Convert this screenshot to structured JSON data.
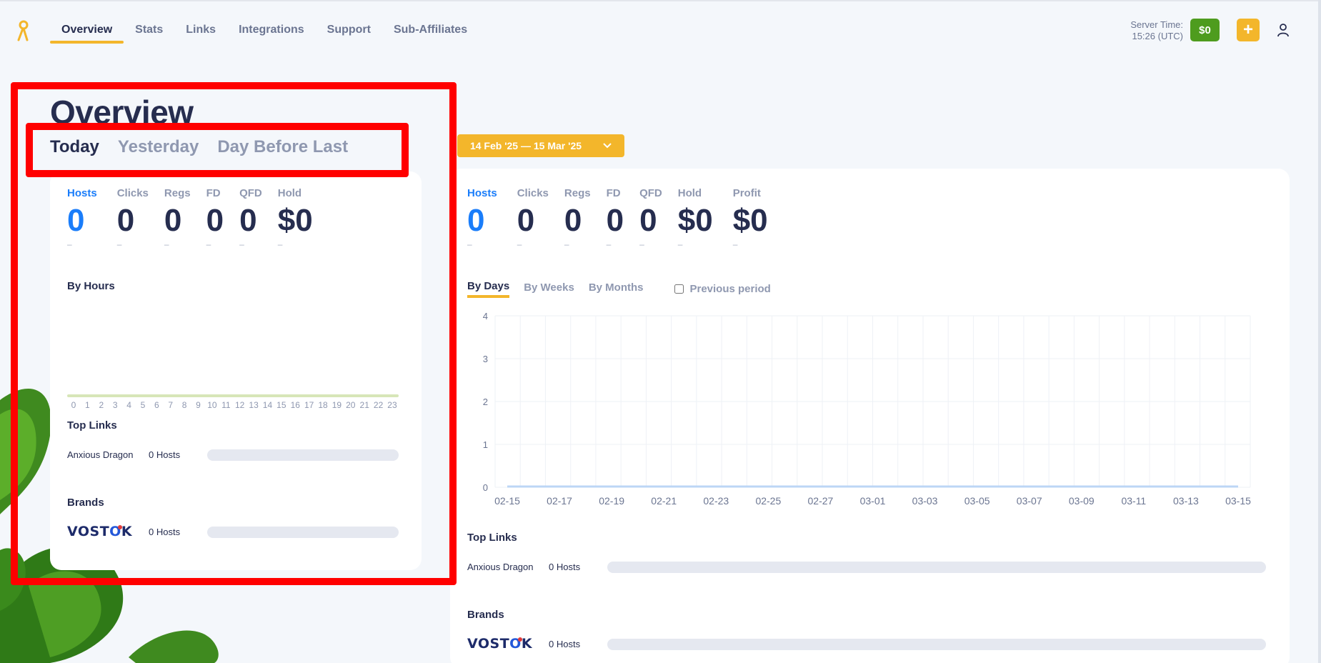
{
  "header": {
    "nav": [
      "Overview",
      "Stats",
      "Links",
      "Integrations",
      "Support",
      "Sub-Affiliates"
    ],
    "server_time_label": "Server Time:",
    "server_time_value": "15:26 (UTC)",
    "balance": "$0",
    "add_label": "+"
  },
  "page": {
    "title": "Overview",
    "period_tabs": [
      "Today",
      "Yesterday",
      "Day Before Last"
    ]
  },
  "today": {
    "metrics": [
      {
        "label": "Hosts",
        "value": "0",
        "sub": "–"
      },
      {
        "label": "Clicks",
        "value": "0",
        "sub": "–"
      },
      {
        "label": "Regs",
        "value": "0",
        "sub": "–"
      },
      {
        "label": "FD",
        "value": "0",
        "sub": "–"
      },
      {
        "label": "QFD",
        "value": "0",
        "sub": "–"
      },
      {
        "label": "Hold",
        "value": "$0",
        "sub": "–"
      }
    ],
    "by_hours_title": "By Hours",
    "hours": [
      "0",
      "1",
      "2",
      "3",
      "4",
      "5",
      "6",
      "7",
      "8",
      "9",
      "10",
      "11",
      "12",
      "13",
      "14",
      "15",
      "16",
      "17",
      "18",
      "19",
      "20",
      "21",
      "22",
      "23"
    ],
    "top_links_title": "Top Links",
    "top_link": {
      "name": "Anxious Dragon",
      "hosts": "0 Hosts"
    },
    "brands_title": "Brands",
    "brand": {
      "name": "VOSTOK",
      "hosts": "0 Hosts"
    }
  },
  "range": {
    "date_range": "14 Feb '25 — 15 Mar '25",
    "metrics": [
      {
        "label": "Hosts",
        "value": "0",
        "sub": "–"
      },
      {
        "label": "Clicks",
        "value": "0",
        "sub": "–"
      },
      {
        "label": "Regs",
        "value": "0",
        "sub": "–"
      },
      {
        "label": "FD",
        "value": "0",
        "sub": "–"
      },
      {
        "label": "QFD",
        "value": "0",
        "sub": "–"
      },
      {
        "label": "Hold",
        "value": "$0",
        "sub": "–"
      },
      {
        "label": "Profit",
        "value": "$0",
        "sub": "–"
      }
    ],
    "grouping_tabs": [
      "By Days",
      "By Weeks",
      "By Months"
    ],
    "previous_period_label": "Previous period",
    "top_links_title": "Top Links",
    "top_link": {
      "name": "Anxious Dragon",
      "hosts": "0 Hosts"
    },
    "brands_title": "Brands",
    "brand": {
      "name": "VOSTOK",
      "hosts": "0 Hosts"
    }
  },
  "chart_data": {
    "type": "line",
    "x": [
      "02-15",
      "02-17",
      "02-19",
      "02-21",
      "02-23",
      "02-25",
      "02-27",
      "03-01",
      "03-03",
      "03-05",
      "03-07",
      "03-09",
      "03-11",
      "03-13",
      "03-15"
    ],
    "series": [
      {
        "values": [
          0,
          0,
          0,
          0,
          0,
          0,
          0,
          0,
          0,
          0,
          0,
          0,
          0,
          0,
          0
        ]
      }
    ],
    "yticks": [
      0,
      1,
      2,
      3,
      4
    ],
    "ylim": [
      0,
      4
    ],
    "grid": true,
    "line_color": "#bcd6f5"
  },
  "colors": {
    "accent": "#f3b62b",
    "active_blue": "#1a7dfa",
    "balance_green": "#4e9c1e",
    "annotation_red": "#ff0000"
  }
}
